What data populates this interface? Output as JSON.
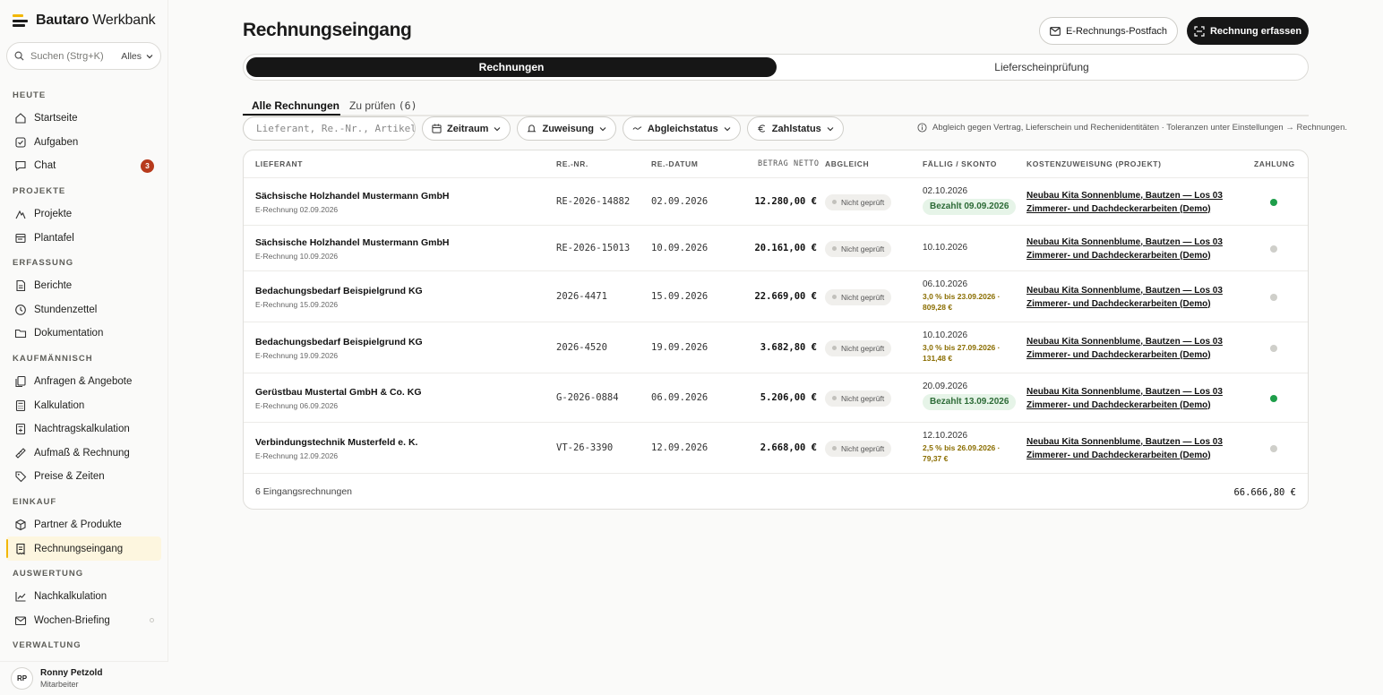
{
  "brand": {
    "bold": "Bautaro",
    "rest": " Werkbank"
  },
  "search": {
    "placeholder": "Suchen (Strg+K)",
    "scope": "Alles"
  },
  "nav": {
    "heute": {
      "title": "HEUTE",
      "items": [
        "Startseite",
        "Aufgaben",
        "Chat"
      ],
      "chat_badge": "3"
    },
    "projekte": {
      "title": "PROJEKTE",
      "items": [
        "Projekte",
        "Plantafel"
      ]
    },
    "erfassung": {
      "title": "ERFASSUNG",
      "items": [
        "Berichte",
        "Stundenzettel",
        "Dokumentation"
      ]
    },
    "kaufmaennisch": {
      "title": "KAUFMÄNNISCH",
      "items": [
        "Anfragen & Angebote",
        "Kalkulation",
        "Nachtragskalkulation",
        "Aufmaß & Rechnung",
        "Preise & Zeiten"
      ]
    },
    "einkauf": {
      "title": "EINKAUF",
      "items": [
        "Partner & Produkte",
        "Rechnungseingang"
      ]
    },
    "auswertung": {
      "title": "AUSWERTUNG",
      "items": [
        "Nachkalkulation",
        "Wochen-Briefing"
      ]
    },
    "verwaltung": {
      "title": "VERWALTUNG"
    }
  },
  "user": {
    "initials": "RP",
    "name": "Ronny Petzold",
    "role": "Mitarbeiter"
  },
  "header": {
    "title": "Rechnungseingang",
    "mailbox_button": "E-Rechnungs-Postfach",
    "capture_button": "Rechnung erfassen"
  },
  "segments": {
    "invoices": "Rechnungen",
    "delivery": "Lieferscheinprüfung"
  },
  "tabs": {
    "all": "Alle Rechnungen",
    "review": "Zu prüfen",
    "review_count": "(6)"
  },
  "filters": {
    "search_placeholder": "Lieferant, Re.-Nr., Artikel",
    "period": "Zeitraum",
    "assignment": "Zuweisung",
    "match_status": "Abgleichstatus",
    "pay_status": "Zahlstatus",
    "hint": "Abgleich gegen Vertrag, Lieferschein und Rechenidentitäten · Toleranzen unter Einstellungen → Rechnungen."
  },
  "table": {
    "columns": {
      "supplier": "LIEFERANT",
      "number": "RE.-NR.",
      "date": "RE.-DATUM",
      "net": "BETRAG NETTO",
      "match": "ABGLEICH",
      "due": "FÄLLIG / SKONTO",
      "cost": "KOSTENZUWEISUNG (PROJEKT)",
      "payment": "ZAHLUNG"
    },
    "rows": [
      {
        "supplier": "Sächsische Holzhandel Mustermann GmbH",
        "sub": "E-Rechnung 02.09.2026",
        "number": "RE-2026-14882",
        "date": "02.09.2026",
        "net": "12.280,00 €",
        "match": "Nicht geprüft",
        "due": "02.10.2026",
        "paid": "Bezahlt 09.09.2026",
        "skonto1": "",
        "skonto2": "",
        "project1": "Neubau Kita Sonnenblume, Bautzen — Los 03",
        "project2": "Zimmerer- und Dachdeckerarbeiten (Demo)",
        "pay_color": "#1e9e4a"
      },
      {
        "supplier": "Sächsische Holzhandel Mustermann GmbH",
        "sub": "E-Rechnung 10.09.2026",
        "number": "RE-2026-15013",
        "date": "10.09.2026",
        "net": "20.161,00 €",
        "match": "Nicht geprüft",
        "due": "10.10.2026",
        "paid": "",
        "skonto1": "",
        "skonto2": "",
        "project1": "Neubau Kita Sonnenblume, Bautzen — Los 03",
        "project2": "Zimmerer- und Dachdeckerarbeiten (Demo)",
        "pay_color": "#cfcfca"
      },
      {
        "supplier": "Bedachungsbedarf Beispielgrund KG",
        "sub": "E-Rechnung 15.09.2026",
        "number": "2026-4471",
        "date": "15.09.2026",
        "net": "22.669,00 €",
        "match": "Nicht geprüft",
        "due": "06.10.2026",
        "paid": "",
        "skonto1": "3,0 % bis 23.09.2026 ·",
        "skonto2": "809,28 €",
        "project1": "Neubau Kita Sonnenblume, Bautzen — Los 03",
        "project2": "Zimmerer- und Dachdeckerarbeiten (Demo)",
        "pay_color": "#cfcfca"
      },
      {
        "supplier": "Bedachungsbedarf Beispielgrund KG",
        "sub": "E-Rechnung 19.09.2026",
        "number": "2026-4520",
        "date": "19.09.2026",
        "net": "3.682,80 €",
        "match": "Nicht geprüft",
        "due": "10.10.2026",
        "paid": "",
        "skonto1": "3,0 % bis 27.09.2026 ·",
        "skonto2": "131,48 €",
        "project1": "Neubau Kita Sonnenblume, Bautzen — Los 03",
        "project2": "Zimmerer- und Dachdeckerarbeiten (Demo)",
        "pay_color": "#cfcfca"
      },
      {
        "supplier": "Gerüstbau Mustertal GmbH & Co. KG",
        "sub": "E-Rechnung 06.09.2026",
        "number": "G-2026-0884",
        "date": "06.09.2026",
        "net": "5.206,00 €",
        "match": "Nicht geprüft",
        "due": "20.09.2026",
        "paid": "Bezahlt 13.09.2026",
        "skonto1": "",
        "skonto2": "",
        "project1": "Neubau Kita Sonnenblume, Bautzen — Los 03",
        "project2": "Zimmerer- und Dachdeckerarbeiten (Demo)",
        "pay_color": "#1e9e4a"
      },
      {
        "supplier": "Verbindungstechnik Musterfeld e. K.",
        "sub": "E-Rechnung 12.09.2026",
        "number": "VT-26-3390",
        "date": "12.09.2026",
        "net": "2.668,00 €",
        "match": "Nicht geprüft",
        "due": "12.10.2026",
        "paid": "",
        "skonto1": "2,5 % bis 26.09.2026 ·",
        "skonto2": "79,37 €",
        "project1": "Neubau Kita Sonnenblume, Bautzen — Los 03",
        "project2": "Zimmerer- und Dachdeckerarbeiten (Demo)",
        "pay_color": "#cfcfca"
      }
    ],
    "footer_count": "6 Eingangsrechnungen",
    "footer_sum": "66.666,80 €"
  }
}
